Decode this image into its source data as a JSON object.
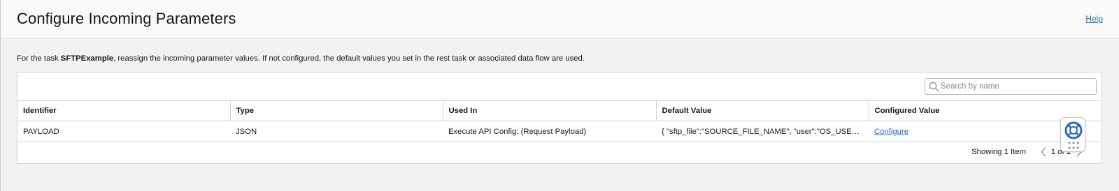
{
  "header": {
    "title": "Configure Incoming Parameters",
    "help_label": "Help"
  },
  "description": {
    "prefix": "For the task ",
    "task_name": "SFTPExample",
    "suffix": ", reassign the incoming parameter values. If not configured, the default values you set in the rest task or associated data flow are used."
  },
  "search": {
    "placeholder": "Search by name",
    "icon": "search-icon"
  },
  "table": {
    "columns": [
      "Identifier",
      "Type",
      "Used In",
      "Default Value",
      "Configured Value"
    ],
    "rows": [
      {
        "identifier": "PAYLOAD",
        "type": "JSON",
        "used_in": "Execute API Config: (Request Payload)",
        "default_value": "{ \"sftp_file\":\"SOURCE_FILE_NAME\", \"user\":\"OS_USER\"…",
        "configured_value": "Configure"
      }
    ]
  },
  "pagination": {
    "showing": "Showing 1 Item",
    "page": "1 of 1"
  },
  "colors": {
    "link": "#2a6db7",
    "border": "#d4d4d4",
    "background": "#f2f2f2"
  },
  "icons": {
    "support": "lifebuoy-icon",
    "grip": "grip-icon",
    "prev": "chevron-left-icon",
    "next": "chevron-right-icon"
  }
}
